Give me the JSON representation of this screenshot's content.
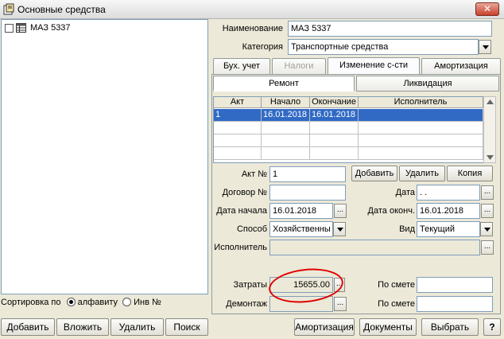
{
  "window": {
    "title": "Основные средства"
  },
  "tree": {
    "items": [
      {
        "label": "МАЗ 5337"
      }
    ]
  },
  "sort": {
    "label": "Сортировка по",
    "option_alpha": "алфавиту",
    "option_inv": "Инв №"
  },
  "left_buttons": {
    "add": "Добавить",
    "insert": "Вложить",
    "delete": "Удалить",
    "search": "Поиск"
  },
  "header": {
    "name_label": "Наименование",
    "name_value": "МАЗ 5337",
    "category_label": "Категория",
    "category_value": "Транспортные средства"
  },
  "tabs": [
    {
      "label": "Бух. учет"
    },
    {
      "label": "Налоги"
    },
    {
      "label": "Изменение с-сти"
    },
    {
      "label": "Амортизация"
    }
  ],
  "subtabs": [
    {
      "label": "Ремонт"
    },
    {
      "label": "Ликвидация"
    }
  ],
  "grid": {
    "columns": [
      "Акт",
      "Начало",
      "Окончание",
      "Исполнитель"
    ],
    "rows": [
      {
        "act": "1",
        "start": "16.01.2018",
        "end": "16.01.2018",
        "executor": ""
      }
    ]
  },
  "form": {
    "act_label": "Акт №",
    "act_value": "1",
    "contract_label": "Договор №",
    "contract_value": "",
    "date_label": "Дата",
    "date_value": ". .",
    "start_label": "Дата начала",
    "start_value": "16.01.2018",
    "end_label": "Дата оконч.",
    "end_value": "16.01.2018",
    "method_label": "Способ",
    "method_value": "Хозяйственны",
    "type_label": "Вид",
    "type_value": "Текущий",
    "executor_label": "Исполнитель",
    "executor_value": "",
    "costs_label": "Затраты",
    "costs_value": "15655.00",
    "estimate_label": "По смете",
    "estimate_value": "",
    "dismantle_label": "Демонтаж",
    "dismantle_value": "",
    "estimate2_label": "По смете",
    "estimate2_value": ""
  },
  "form_buttons": {
    "add": "Добавить",
    "delete": "Удалить",
    "copy": "Копия"
  },
  "bottom_buttons": {
    "amort": "Амортизация",
    "docs": "Документы",
    "select": "Выбрать",
    "help": "?"
  },
  "colors": {
    "selection": "#316ac5",
    "highlight_circle": "#e00000"
  }
}
